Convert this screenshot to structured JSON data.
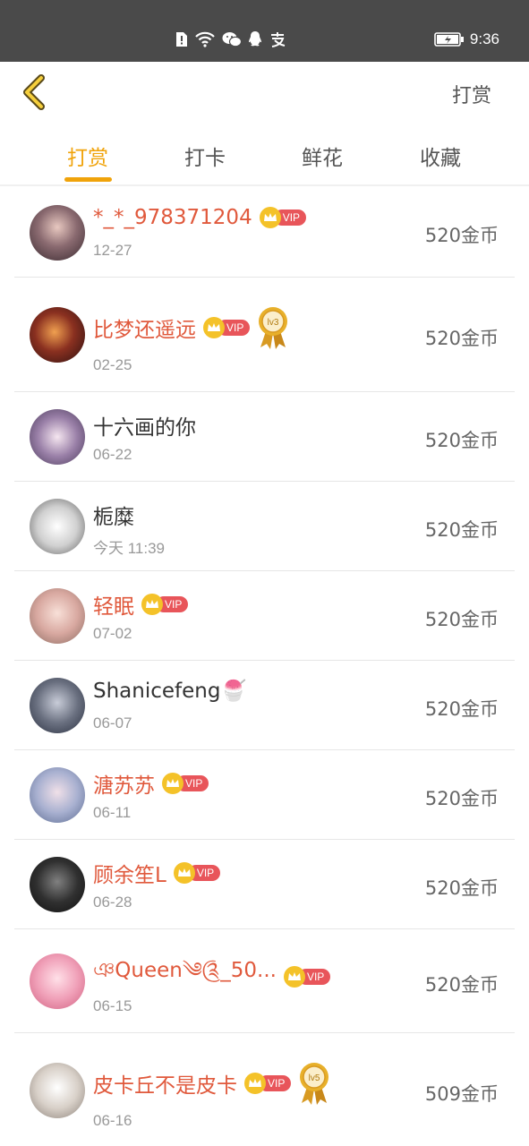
{
  "status_bar": {
    "time": "9:36",
    "icons": [
      "sim-alert-icon",
      "wifi-icon",
      "wechat-icon",
      "qq-icon",
      "alipay-icon",
      "battery-icon"
    ]
  },
  "header": {
    "back_icon": "chevron-left-icon",
    "action_label": "打赏"
  },
  "tabs": [
    {
      "label": "打赏",
      "active": true
    },
    {
      "label": "打卡",
      "active": false
    },
    {
      "label": "鲜花",
      "active": false
    },
    {
      "label": "收藏",
      "active": false
    }
  ],
  "rewards": [
    {
      "name": "*_*_978371204",
      "date": "12-27",
      "coins": "520金币",
      "vip": true,
      "level": "",
      "vip_label": "VIP"
    },
    {
      "name": "比梦还遥远",
      "date": "02-25",
      "coins": "520金币",
      "vip": true,
      "level": "lv3",
      "vip_label": "VIP"
    },
    {
      "name": "十六画的你",
      "date": "06-22",
      "coins": "520金币",
      "vip": false,
      "level": "",
      "vip_label": ""
    },
    {
      "name": "栀糜",
      "date": "今天 11:39",
      "coins": "520金币",
      "vip": false,
      "level": "",
      "vip_label": ""
    },
    {
      "name": "轻眠",
      "date": "07-02",
      "coins": "520金币",
      "vip": true,
      "level": "",
      "vip_label": "VIP"
    },
    {
      "name": "Shanicefeng🍧",
      "date": "06-07",
      "coins": "520金币",
      "vip": false,
      "level": "",
      "vip_label": ""
    },
    {
      "name": "溏苏苏",
      "date": "06-11",
      "coins": "520金币",
      "vip": true,
      "level": "",
      "vip_label": "VIP"
    },
    {
      "name": "顾余笙L",
      "date": "06-28",
      "coins": "520金币",
      "vip": true,
      "level": "",
      "vip_label": "VIP"
    },
    {
      "name": "ঞQueen༄༊_50...",
      "date": "06-15",
      "coins": "520金币",
      "vip": true,
      "level": "",
      "vip_label": "VIP"
    },
    {
      "name": "皮卡丘不是皮卡",
      "date": "06-16",
      "coins": "509金币",
      "vip": true,
      "level": "lv5",
      "vip_label": "VIP"
    }
  ],
  "colors": {
    "accent": "#f0a30a",
    "vip_name": "#e0593c",
    "vip_pill": "#e8555a",
    "crown": "#f4c229",
    "status_bar": "#4a4a4a"
  }
}
